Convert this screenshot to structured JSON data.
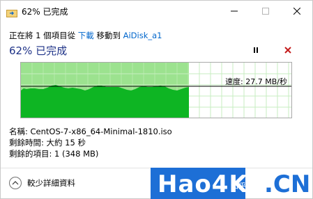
{
  "titlebar": {
    "title": "62% 已完成",
    "icon": "copy-progress-icon"
  },
  "status": {
    "prefix": "正在將 1 個項目從",
    "source": "下載",
    "middle": "移動到",
    "destination": "AiDisk_a1"
  },
  "headline": "62% 已完成",
  "progress": {
    "percent": 62,
    "speed_label": "速度: 27.7 MB/秒"
  },
  "info": {
    "name": "名稱: CentOS-7-x86_64-Minimal-1810.iso",
    "time_remaining": "剩餘時間: 大約 15 秒",
    "items_remaining": "剩餘的項目: 1 (348 MB)"
  },
  "footer": {
    "details_label": "較少詳細資料"
  },
  "watermark": {
    "brand": "Hao4K",
    "suffix": ".CN",
    "zhihu": "知乎 @晴天萌哥"
  },
  "colors": {
    "progress_fill": "#0eb523",
    "progress_background": "#9ce28f",
    "grid_line": "#c7eec0",
    "watermark_blue": "#1d6fd6"
  }
}
